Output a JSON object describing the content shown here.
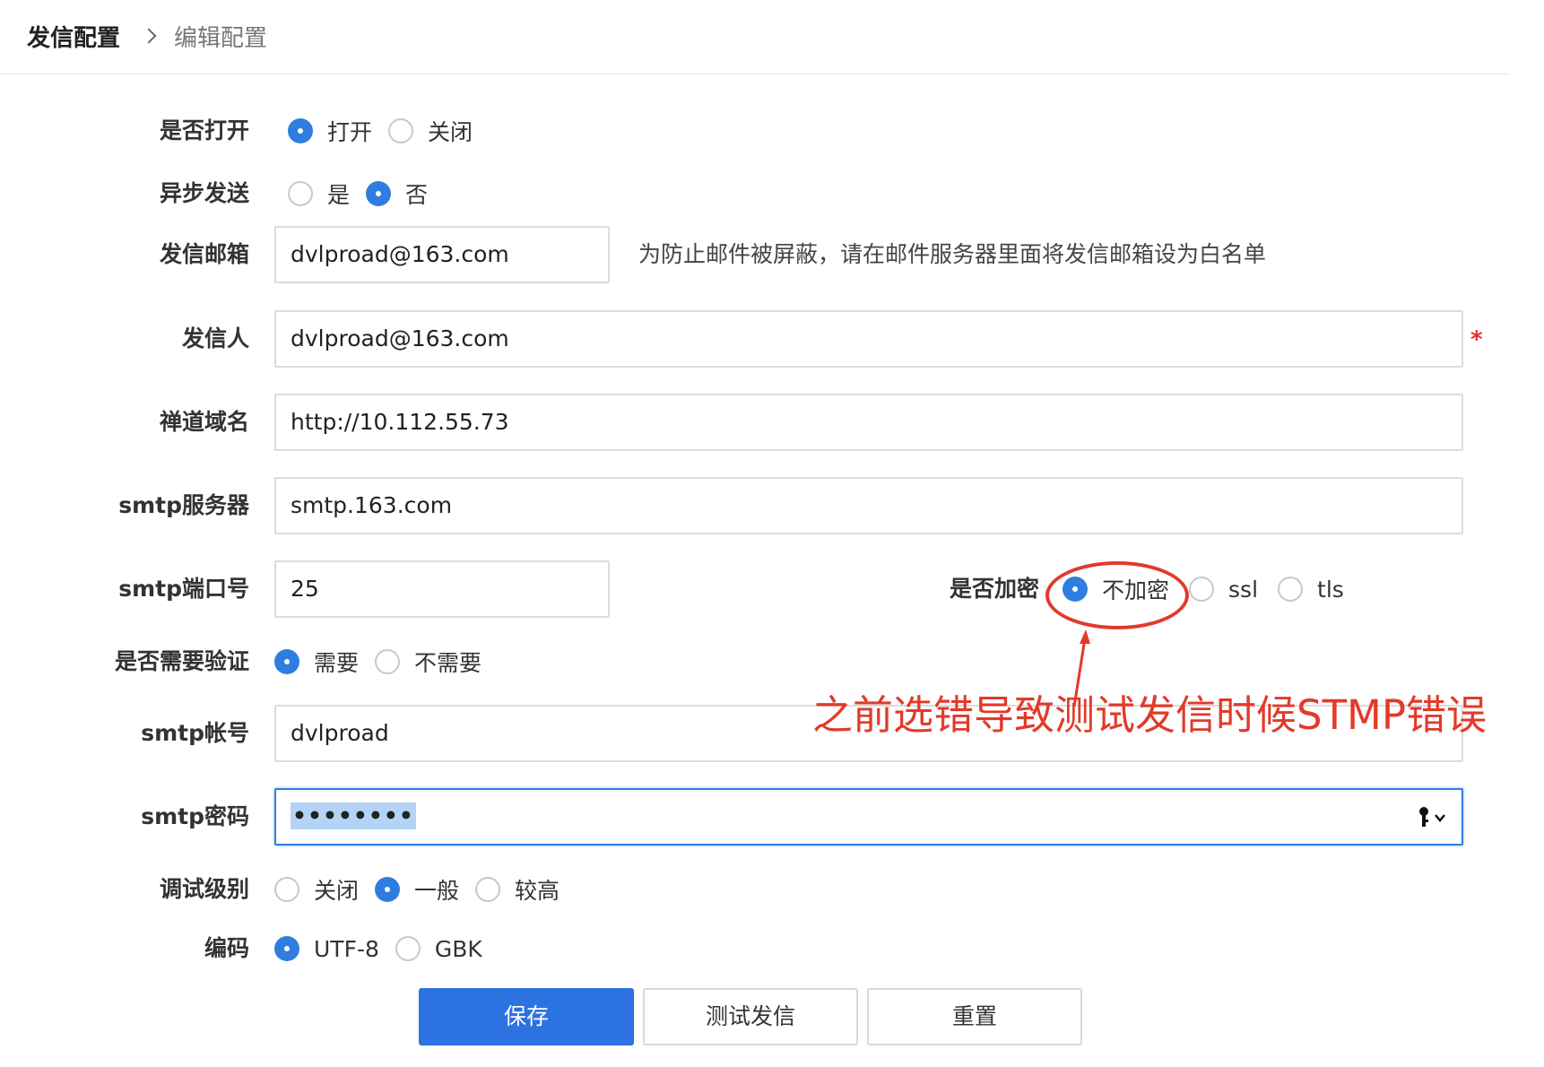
{
  "breadcrumb": {
    "root": "发信配置",
    "current": "编辑配置"
  },
  "form": {
    "enabled": {
      "label": "是否打开",
      "options": [
        "打开",
        "关闭"
      ],
      "selected": "打开"
    },
    "async_send": {
      "label": "异步发送",
      "options": [
        "是",
        "否"
      ],
      "selected": "否"
    },
    "sender_email": {
      "label": "发信邮箱",
      "value": "dvlproad@163.com",
      "hint": "为防止邮件被屏蔽，请在邮件服务器里面将发信邮箱设为白名单"
    },
    "sender_name": {
      "label": "发信人",
      "value": "dvlproad@163.com",
      "required_mark": "*"
    },
    "zentao_domain": {
      "label": "禅道域名",
      "value": "http://10.112.55.73"
    },
    "smtp_server": {
      "label": "smtp服务器",
      "value": "smtp.163.com"
    },
    "smtp_port": {
      "label": "smtp端口号",
      "value": "25"
    },
    "encryption": {
      "label": "是否加密",
      "options": [
        "不加密",
        "ssl",
        "tls"
      ],
      "selected": "不加密"
    },
    "auth_required": {
      "label": "是否需要验证",
      "options": [
        "需要",
        "不需要"
      ],
      "selected": "需要"
    },
    "smtp_account": {
      "label": "smtp帐号",
      "value": "dvlproad"
    },
    "smtp_password": {
      "label": "smtp密码",
      "value": "••••••••"
    },
    "debug_level": {
      "label": "调试级别",
      "options": [
        "关闭",
        "一般",
        "较高"
      ],
      "selected": "一般"
    },
    "charset": {
      "label": "编码",
      "options": [
        "UTF-8",
        "GBK"
      ],
      "selected": "UTF-8"
    }
  },
  "buttons": {
    "save": "保存",
    "test_send": "测试发信",
    "reset": "重置"
  },
  "annotation": {
    "text": "之前选错导致测试发信时候STMP错误"
  },
  "colors": {
    "accent": "#2f7de1",
    "primary_button": "#2c72e0",
    "annotation": "#e23a2a",
    "required": "#e5302f"
  },
  "icons": {
    "password_manager": "key-icon",
    "breadcrumb_separator": "chevron-right-icon"
  }
}
